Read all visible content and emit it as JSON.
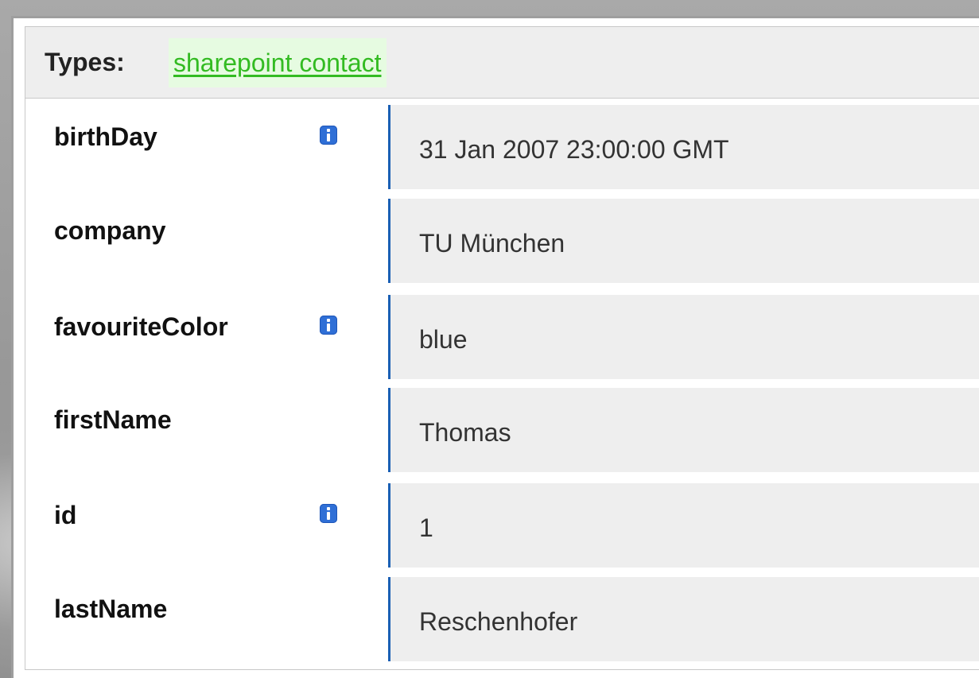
{
  "types": {
    "label": "Types:",
    "value": "sharepoint contact"
  },
  "properties": [
    {
      "name": "birthDay",
      "has_info": true,
      "value": "31 Jan 2007 23:00:00 GMT"
    },
    {
      "name": "company",
      "has_info": false,
      "value": "TU München"
    },
    {
      "name": "favouriteColor",
      "has_info": true,
      "value": "blue"
    },
    {
      "name": "firstName",
      "has_info": false,
      "value": "Thomas"
    },
    {
      "name": "id",
      "has_info": true,
      "value": "1"
    },
    {
      "name": "lastName",
      "has_info": false,
      "value": "Reschenhofer"
    }
  ],
  "icons": {
    "info": "info-icon"
  },
  "colors": {
    "type_link": "#33bb22",
    "type_link_bg": "#e6fbe1",
    "value_border": "#1a5fb4",
    "info_icon": "#2f6fd6",
    "cell_bg": "#eeeeee"
  }
}
